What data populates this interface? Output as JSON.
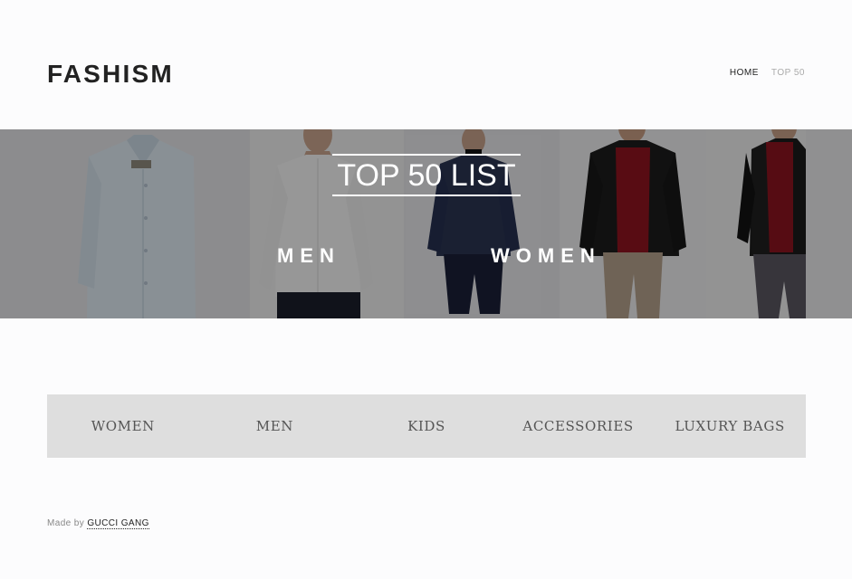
{
  "header": {
    "logo": "FASHISM",
    "nav": [
      {
        "label": "HOME",
        "active": true
      },
      {
        "label": "TOP 50",
        "active": false
      }
    ]
  },
  "hero": {
    "title": "TOP 50 LIST",
    "links": [
      "MEN",
      "WOMEN"
    ],
    "images": [
      "light-blue dress shirt",
      "model in white shirt and dark trousers",
      "model in navy check blazer",
      "model in black jacket and red sweater",
      "model in black vest and red sweater"
    ]
  },
  "categories": [
    "WOMEN",
    "MEN",
    "KIDS",
    "ACCESSORIES",
    "LUXURY BAGS"
  ],
  "footer": {
    "prefix": "Made by",
    "author": "GUCCI GANG"
  },
  "colors": {
    "background": "#fcfcfd",
    "category_bar": "#dedede",
    "text_dark": "#222222",
    "nav_muted": "#aaaaaa"
  }
}
